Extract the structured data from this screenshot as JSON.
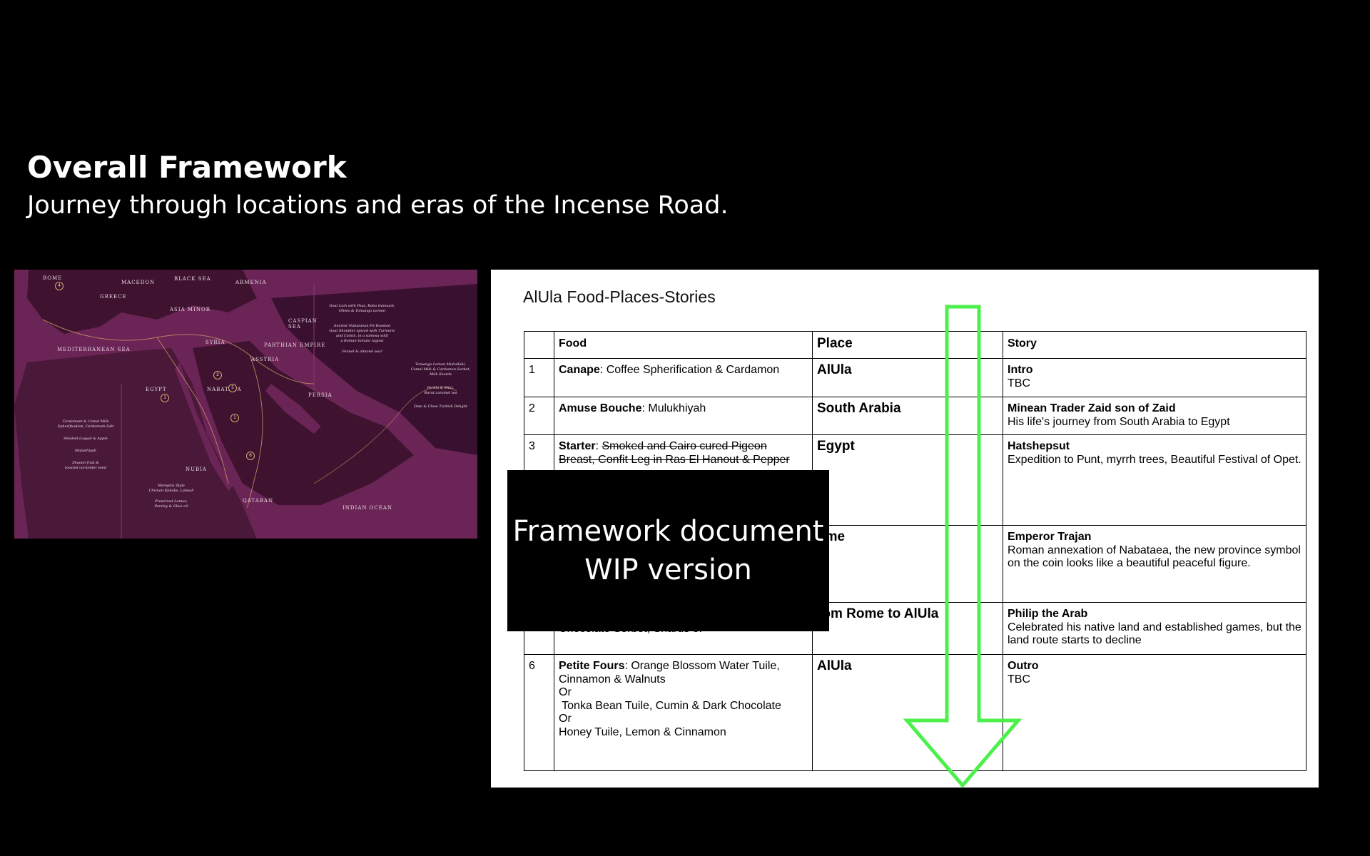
{
  "header": {
    "title": "Overall Framework",
    "subtitle": "Journey through locations and eras of the Incense Road."
  },
  "map": {
    "regions": [
      "MEDITERRANEAN SEA",
      "ASIA MINOR",
      "SYRIA",
      "ASSYRIA",
      "PARTHIAN EMPIRE",
      "EGYPT",
      "NABATAEA",
      "PERSIA",
      "NUBIA",
      "QATABAN",
      "INDIAN OCEAN",
      "BLACK SEA",
      "ARMENIA",
      "CASPIAN SEA",
      "ROME",
      "MACEDON",
      "GREECE"
    ],
    "stop_markers": [
      "1",
      "2",
      "3",
      "4",
      "5",
      "6"
    ],
    "menu_notes": {
      "c1": [
        "Cardamom & Camel Milk",
        "Spherification, Cardamom Salt"
      ],
      "c2": [
        "Smoked Laquat & Apple",
        "Mulukhiyah"
      ],
      "c3": [
        "Shaoon fruit &",
        "toasted coriander seed"
      ],
      "c4": [
        "Memphis Style",
        "Chicken Kebabs, Labneh",
        "Preserved Lemon,",
        "Parsley & Olive oil"
      ],
      "c5": [
        "Goat Loin with Peas, Baba Ganoush,",
        "Olives & Tomango Lemon",
        "Ancient Nabataean Fit Roasted",
        "Goat Shoulder spiced with Turmeric",
        "and Cumin, in a samosa with",
        "a Roman tomato ragout",
        "Fennel & almond sour"
      ],
      "c6": [
        "Tomango Lemon Muhallebi,",
        "Camel Milk & Cardamon Sorbet,",
        "Milk Shards",
        "Perilla & Mint,",
        "Burnt caramel tea",
        "Date & Clove Turkish Delight"
      ]
    }
  },
  "document": {
    "title": "AlUla Food-Places-Stories",
    "headers": {
      "num": "",
      "food": "Food",
      "place": "Place",
      "story": "Story"
    },
    "rows": [
      {
        "num": "1",
        "food_bold": "Canape",
        "food_rest": ": Coffee Spherification & Cardamon",
        "place": "AlUla",
        "story_title": "Intro",
        "story_text": "TBC"
      },
      {
        "num": "2",
        "food_bold": "Amuse Bouche",
        "food_rest": ": Mulukhiyah",
        "place": "South Arabia",
        "story_title": "Minean Trader Zaid son of Zaid",
        "story_text": "His life's journey from South Arabia to Egypt"
      },
      {
        "num": "3",
        "food_bold": "Starter",
        "food_sep": ": ",
        "food_strike_1": "Smoked and Cairo cured Pigeon",
        "food_strike_2": "Breast, Confit Leg in Ras El Hanout & Pepper",
        "place": "Egypt",
        "story_title": "Hatshepsut",
        "story_text": "Expedition to Punt, myrrh trees, Beautiful Festival of Opet."
      },
      {
        "num": "",
        "food": "",
        "place": "ome",
        "story_title": "Emperor Trajan",
        "story_text": "Roman annexation of Nabataea, the new province symbol on the coin looks like a beautiful peaceful figure."
      },
      {
        "num": "",
        "food": "Chocolate Sorbet, Shards of",
        "place": "rom Rome to AlUla",
        "story_title": "Philip the Arab",
        "story_text": "Celebrated his native land and established games, but the land route starts to decline"
      },
      {
        "num": "6",
        "food_bold": "Petite Fours",
        "food_rest": ": Orange Blossom Water Tuile,",
        "food_line2": "Cinnamon & Walnuts",
        "food_line3": "Or",
        "food_line4": " Tonka Bean Tuile, Cumin & Dark Chocolate",
        "food_line5": "Or",
        "food_line6": "Honey Tuile, Lemon & Cinnamon",
        "place": "AlUla",
        "story_title": "Outro",
        "story_text": "TBC"
      }
    ]
  },
  "overlay": {
    "line1": "Framework document",
    "line2": "WIP version"
  },
  "colors": {
    "background": "#000000",
    "map_sea": "#6b2456",
    "map_land": "#3f1330",
    "map_route": "#d8a86a",
    "arrow": "#4cf04a"
  },
  "icons": {
    "arrow": "down-arrow-icon"
  }
}
